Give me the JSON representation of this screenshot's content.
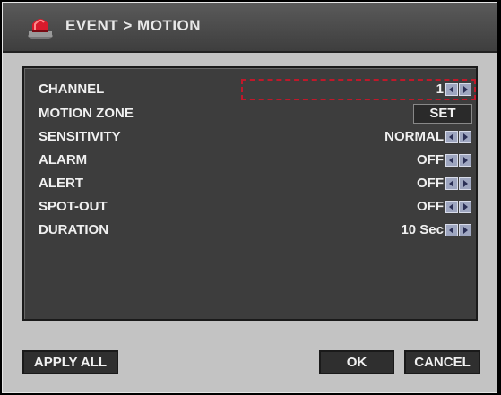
{
  "title": {
    "text": "EVENT > MOTION",
    "icon": "alarm-light-icon"
  },
  "rows": {
    "channel": {
      "label": "CHANNEL",
      "value": "1"
    },
    "motion_zone": {
      "label": "MOTION ZONE",
      "button": "SET"
    },
    "sensitivity": {
      "label": "SENSITIVITY",
      "value": "NORMAL"
    },
    "alarm": {
      "label": "ALARM",
      "value": "OFF"
    },
    "alert": {
      "label": "ALERT",
      "value": "OFF"
    },
    "spot_out": {
      "label": "SPOT-OUT",
      "value": "OFF"
    },
    "duration": {
      "label": "DURATION",
      "value": "10 Sec"
    }
  },
  "buttons": {
    "apply_all": "APPLY ALL",
    "ok": "OK",
    "cancel": "CANCEL"
  },
  "colors": {
    "selection": "#c0182a",
    "panel": "#3d3d3d",
    "window": "#c3c3c3"
  }
}
